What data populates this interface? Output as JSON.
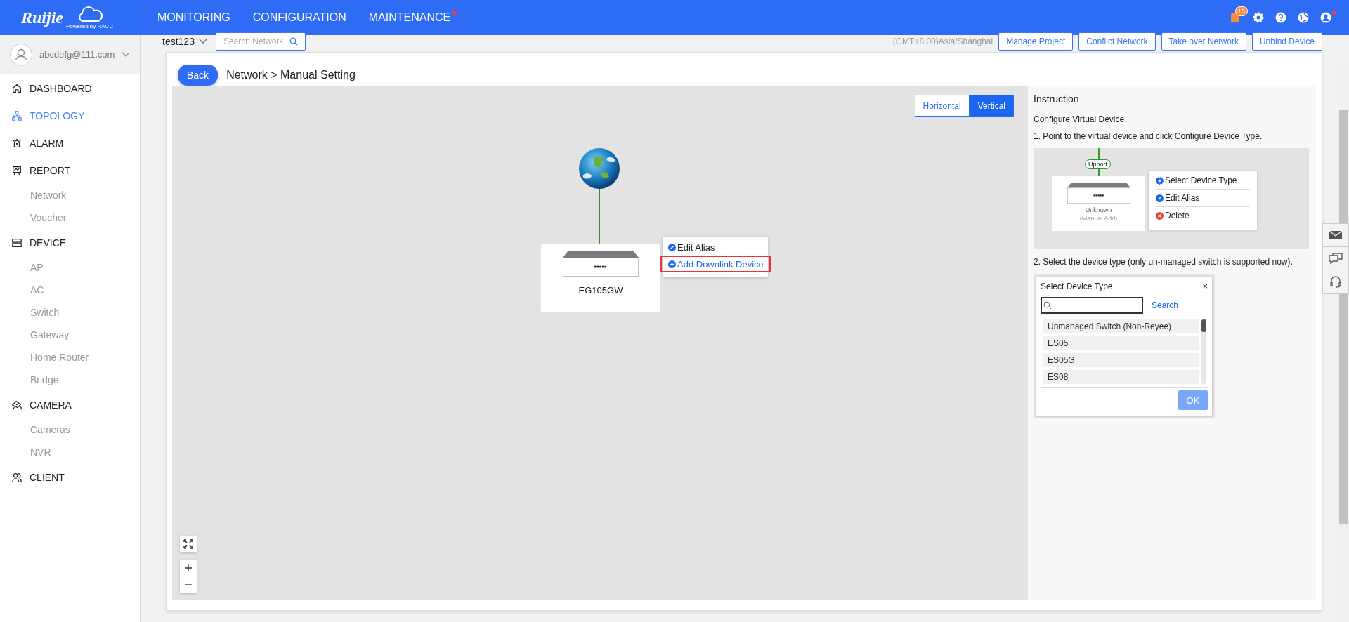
{
  "header": {
    "logo": "Ruijie",
    "logo_tagline": "Powered by RACC",
    "nav": [
      {
        "label": "MONITORING",
        "alert": false
      },
      {
        "label": "CONFIGURATION",
        "alert": false
      },
      {
        "label": "MAINTENANCE",
        "alert": true
      }
    ],
    "notification_count": "15",
    "user_alert": true
  },
  "sidebar": {
    "account": "abcdefg@111.com",
    "items": [
      {
        "label": "DASHBOARD",
        "selected": false
      },
      {
        "label": "TOPOLOGY",
        "selected": true
      },
      {
        "label": "ALARM",
        "selected": false
      },
      {
        "label": "REPORT",
        "selected": false,
        "children": [
          {
            "label": "Network",
            "selected": false
          },
          {
            "label": "Voucher",
            "selected": false
          }
        ]
      },
      {
        "label": "DEVICE",
        "selected": false,
        "children": [
          {
            "label": "AP",
            "selected": false
          },
          {
            "label": "AC",
            "selected": false
          },
          {
            "label": "Switch",
            "selected": false
          },
          {
            "label": "Gateway",
            "selected": false
          },
          {
            "label": "Home Router",
            "selected": false
          },
          {
            "label": "Bridge",
            "selected": false
          }
        ]
      },
      {
        "label": "CAMERA",
        "selected": false,
        "children": [
          {
            "label": "Cameras",
            "selected": false
          },
          {
            "label": "NVR",
            "selected": false
          }
        ]
      },
      {
        "label": "CLIENT",
        "selected": false
      }
    ]
  },
  "toolbar": {
    "project": "test123",
    "search_placeholder": "Search Network",
    "timezone": "(GMT+8:00)Asia/Shanghai",
    "buttons": [
      "Manage Project",
      "Conflict Network",
      "Take over Network",
      "Unbind Device"
    ]
  },
  "dialog": {
    "back": "Back",
    "breadcrumb": "Network > Manual Setting",
    "layout_toggle": [
      {
        "label": "Horizontal",
        "selected": false
      },
      {
        "label": "Vertical",
        "selected": true
      }
    ],
    "device": {
      "name": "EG105GW"
    },
    "context_menu": [
      {
        "label": "Edit Alias",
        "kind": "edit",
        "highlighted": false
      },
      {
        "label": "Add Downlink Device",
        "kind": "add",
        "highlighted": true
      }
    ],
    "instruction": {
      "title": "Instruction",
      "subtitle": "Configure Virtual Device",
      "step_1": "1. Point to the virtual device and click Configure Device Type.",
      "example": {
        "port": "Upport",
        "device_name": "Unknown",
        "device_note": "(Manual Add)",
        "menu": [
          {
            "label": "Select Device Type",
            "kind": "settings"
          },
          {
            "label": "Edit Alias",
            "kind": "edit"
          },
          {
            "label": "Delete",
            "kind": "delete"
          }
        ]
      },
      "step_2": "2. Select the device type (only un-managed switch is supported now).",
      "type_dialog": {
        "title": "Select Device Type",
        "close": "×",
        "search": "Search",
        "options": [
          "Unmanaged Switch (Non-Reyee)",
          "ES05",
          "ES05G",
          "ES08"
        ],
        "ok": "OK"
      }
    }
  }
}
